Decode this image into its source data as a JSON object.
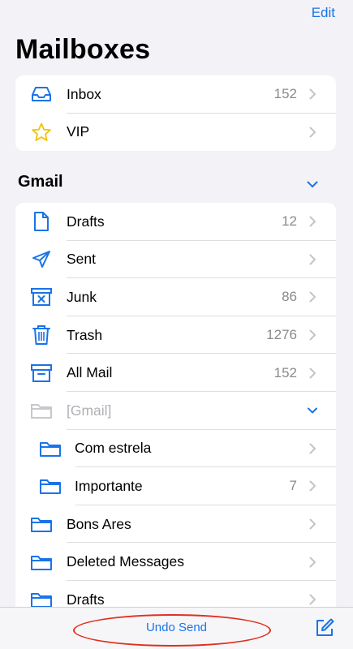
{
  "header": {
    "edit_label": "Edit",
    "title": "Mailboxes"
  },
  "top_group": [
    {
      "label": "Inbox",
      "count": "152",
      "icon": "inbox-icon"
    },
    {
      "label": "VIP",
      "count": "",
      "icon": "star-icon"
    }
  ],
  "gmail": {
    "header": "Gmail",
    "items": [
      {
        "label": "Drafts",
        "count": "12",
        "icon": "document-icon"
      },
      {
        "label": "Sent",
        "count": "",
        "icon": "paper-plane-icon"
      },
      {
        "label": "Junk",
        "count": "86",
        "icon": "junk-icon"
      },
      {
        "label": "Trash",
        "count": "1276",
        "icon": "trash-icon"
      },
      {
        "label": "All Mail",
        "count": "152",
        "icon": "archive-box-icon"
      },
      {
        "label": "[Gmail]",
        "count": "",
        "icon": "folder-icon"
      },
      {
        "label": "Com estrela",
        "count": "",
        "icon": "folder-icon"
      },
      {
        "label": "Importante",
        "count": "7",
        "icon": "folder-icon"
      },
      {
        "label": "Bons Ares",
        "count": "",
        "icon": "folder-icon"
      },
      {
        "label": "Deleted Messages",
        "count": "",
        "icon": "folder-icon"
      },
      {
        "label": "Drafts",
        "count": "",
        "icon": "folder-icon"
      }
    ]
  },
  "toolbar": {
    "undo_label": "Undo Send",
    "compose_icon": "compose-icon"
  },
  "colors": {
    "accent": "#1a73e8",
    "vip_star": "#f2c200",
    "annotation": "#e0301e",
    "background": "#f2f2f7"
  }
}
